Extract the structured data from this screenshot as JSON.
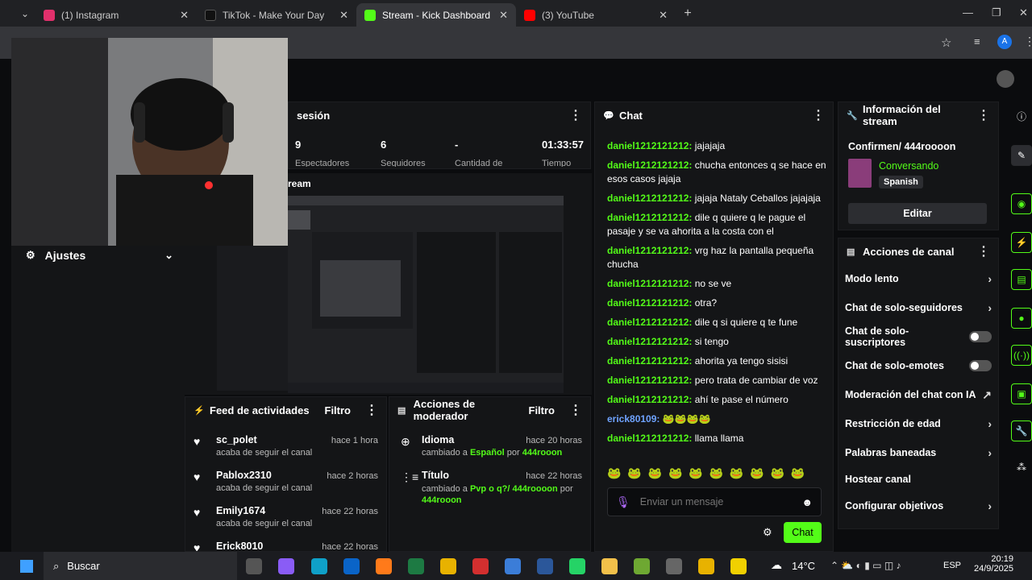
{
  "tabs": [
    {
      "title": "(1) Instagram",
      "color": "#e1306c"
    },
    {
      "title": "TikTok - Make Your Day",
      "color": "#111111"
    },
    {
      "title": "Stream - Kick Dashboard",
      "color": "#53fc18"
    },
    {
      "title": "(3) YouTube",
      "color": "#ff0000"
    }
  ],
  "session": {
    "title": "sesión",
    "stats": [
      "9",
      "6",
      "-",
      "01:33:57"
    ],
    "labels": [
      "Espectadores",
      "Seguidores",
      "Cantidad de",
      "Tiempo"
    ]
  },
  "preview_title": "ream",
  "ajustes": "Ajustes",
  "chat": {
    "title": "Chat",
    "messages": [
      {
        "user": "daniel1212121212:",
        "text": " jajajaja"
      },
      {
        "user": "daniel1212121212:",
        "text": " chucha entonces q se hace en esos casos jajaja"
      },
      {
        "user": "daniel1212121212:",
        "text": " jajaja Nataly Ceballos jajajaja"
      },
      {
        "user": "daniel1212121212:",
        "text": " dile q quiere q le pague el pasaje y se va ahorita a la costa con el"
      },
      {
        "user": "daniel1212121212:",
        "text": " vrg haz la pantalla pequeña chucha"
      },
      {
        "user": "daniel1212121212:",
        "text": " no se ve"
      },
      {
        "user": "daniel1212121212:",
        "text": " otra?"
      },
      {
        "user": "daniel1212121212:",
        "text": " dile q si quiere q te fune"
      },
      {
        "user": "daniel1212121212:",
        "text": " si tengo"
      },
      {
        "user": "daniel1212121212:",
        "text": " ahorita ya tengo sisisi"
      },
      {
        "user": "daniel1212121212:",
        "text": " pero trata de cambiar de voz"
      },
      {
        "user": "daniel1212121212:",
        "text": " ahí te pase el número"
      },
      {
        "user": "erick80109:",
        "text": " 🐸🐸🐸🐸",
        "blue": true
      },
      {
        "user": "daniel1212121212:",
        "text": " llama llama"
      }
    ],
    "emotes": "🐸 🐸 🐸 🐸 🐸 🐸 🐸 🐸 🐸 🐸",
    "placeholder": "Enviar un mensaje",
    "send": "Chat"
  },
  "info": {
    "title": "Información del stream",
    "stream_title": "Confirmen/ 444roooon",
    "category": "Conversando",
    "language": "Spanish",
    "edit": "Editar"
  },
  "channel": {
    "title": "Acciones de canal",
    "items": [
      {
        "label": "Modo lento",
        "kind": "arrow"
      },
      {
        "label": "Chat de solo-seguidores",
        "kind": "arrow"
      },
      {
        "label": "Chat de solo-suscriptores",
        "kind": "toggle"
      },
      {
        "label": "Chat de solo-emotes",
        "kind": "toggle"
      },
      {
        "label": "Moderación del chat con IA",
        "kind": "ext"
      },
      {
        "label": "Restricción de edad",
        "kind": "arrow"
      },
      {
        "label": "Palabras baneadas",
        "kind": "arrow"
      },
      {
        "label": "Hostear canal",
        "kind": "none"
      },
      {
        "label": "Configurar objetivos",
        "kind": "arrow"
      }
    ]
  },
  "feed": {
    "title": "Feed de actividades",
    "filter": "Filtro",
    "items": [
      {
        "name": "sc_polet",
        "sub": "acaba de seguir el canal",
        "time": "hace 1 hora"
      },
      {
        "name": "Pablox2310",
        "sub": "acaba de seguir el canal",
        "time": "hace 2 horas"
      },
      {
        "name": "Emily1674",
        "sub": "acaba de seguir el canal",
        "time": "hace 22 horas"
      },
      {
        "name": "Erick8010",
        "sub": "",
        "time": "hace 22 horas"
      }
    ]
  },
  "mod": {
    "title": "Acciones de moderador",
    "filter": "Filtro",
    "items": [
      {
        "name": "Idioma",
        "time": "hace 20 horas",
        "pre": "cambiado a ",
        "val": "Español",
        "mid": " por ",
        "by": "444rooon"
      },
      {
        "name": "Título",
        "time": "hace 22 horas",
        "pre": "cambiado a ",
        "val": "Pvp o q?/ 444roooon",
        "mid": " por ",
        "by": "444rooon"
      }
    ]
  },
  "taskbar": {
    "search": "Buscar",
    "temp": "14°C",
    "lang": "ESP",
    "time": "20:19",
    "date": "24/9/2025"
  }
}
